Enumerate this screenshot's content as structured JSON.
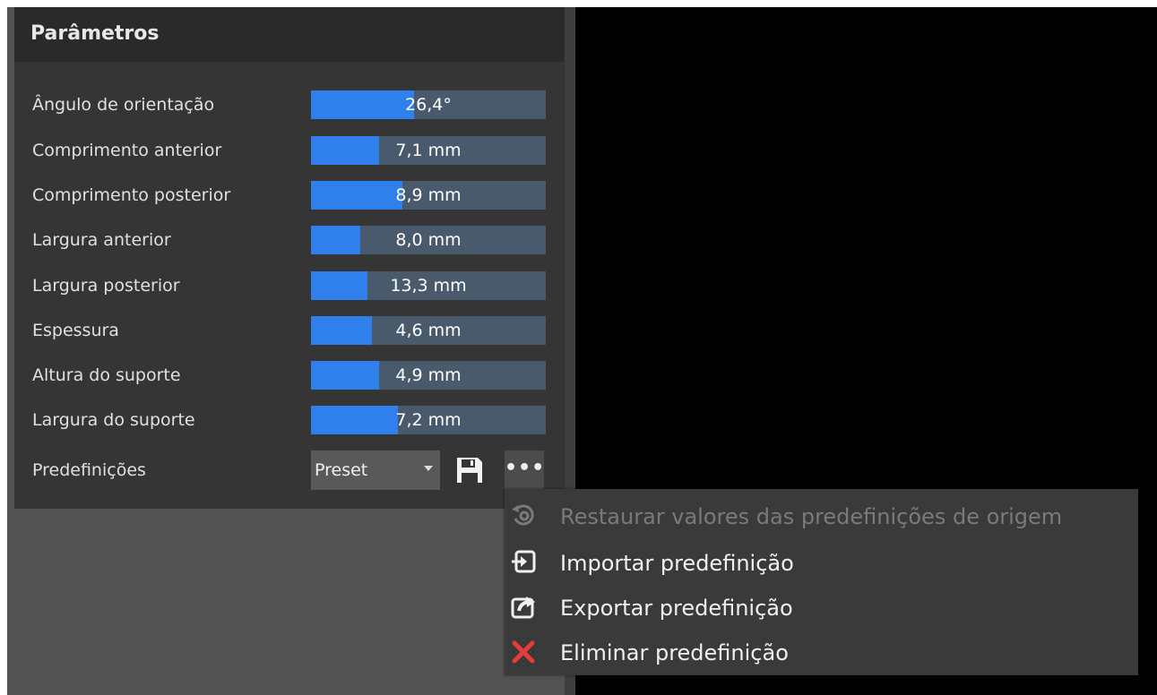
{
  "panel": {
    "title": "Parâmetros",
    "params": [
      {
        "label": "Ângulo de orientação",
        "value": "26,4°",
        "fill_pct": 44
      },
      {
        "label": "Comprimento anterior",
        "value": "7,1 mm",
        "fill_pct": 29
      },
      {
        "label": "Comprimento posterior",
        "value": "8,9 mm",
        "fill_pct": 39
      },
      {
        "label": "Largura anterior",
        "value": "8,0 mm",
        "fill_pct": 21
      },
      {
        "label": "Largura posterior",
        "value": "13,3 mm",
        "fill_pct": 24
      },
      {
        "label": "Espessura",
        "value": "4,6 mm",
        "fill_pct": 26
      },
      {
        "label": "Altura do suporte",
        "value": "4,9 mm",
        "fill_pct": 29
      },
      {
        "label": "Largura do suporte",
        "value": "7,2 mm",
        "fill_pct": 37
      }
    ],
    "presets": {
      "label": "Predefinições",
      "selected": "Preset",
      "save_icon": "floppy-disk-icon",
      "more_label": "•••"
    }
  },
  "context_menu": {
    "items": [
      {
        "label": "Restaurar valores das predefinições de origem",
        "icon": "restore-icon",
        "enabled": false
      },
      {
        "label": "Importar predefinição",
        "icon": "import-icon",
        "enabled": true
      },
      {
        "label": "Exportar predefinição",
        "icon": "export-icon",
        "enabled": true
      },
      {
        "label": "Eliminar predefinição",
        "icon": "delete-x-icon",
        "enabled": true
      }
    ]
  },
  "colors": {
    "accent": "#2f80ed",
    "slider_track": "#485a6c",
    "panel_bg": "#353535",
    "header_bg": "#2a2a2a",
    "menu_bg": "#3a3a3a",
    "delete_red": "#e23c3c",
    "viewport_bg": "#000000"
  }
}
